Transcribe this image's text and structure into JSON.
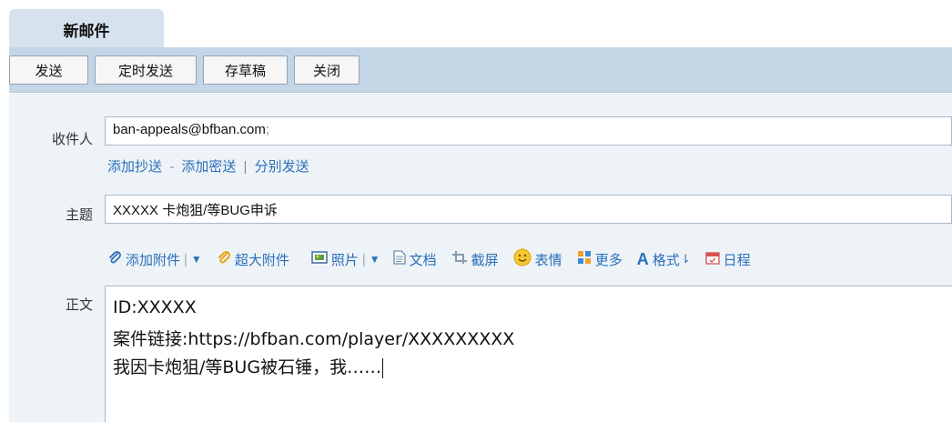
{
  "tab": {
    "title": "新邮件"
  },
  "toolbar": {
    "send": "发送",
    "scheduled_send": "定时发送",
    "save_draft": "存草稿",
    "close": "关闭"
  },
  "recipient": {
    "label": "收件人",
    "value": "ban-appeals@bfban.com",
    "separator": ";",
    "add_cc": "添加抄送",
    "dash": "-",
    "add_bcc": "添加密送",
    "pipe": "|",
    "separate_send": "分别发送"
  },
  "subject": {
    "label": "主题",
    "value": "XXXXX 卡炮狙/等BUG申诉"
  },
  "attach_bar": {
    "add_attachment": "添加附件",
    "large_attachment": "超大附件",
    "photo": "照片",
    "document": "文档",
    "screenshot": "截屏",
    "emoji": "表情",
    "more": "更多",
    "format": "格式",
    "schedule": "日程",
    "icons": [
      "paperclip-icon",
      "large-attachment-icon",
      "photo-icon",
      "document-icon",
      "screenshot-icon",
      "emoji-icon",
      "more-icon",
      "format-icon",
      "calendar-icon"
    ]
  },
  "body": {
    "label": "正文",
    "lines": [
      "ID:XXXXX",
      "案件链接:https://bfban.com/player/XXXXXXXXX",
      "我因卡炮狙/等BUG被石锤，我……"
    ]
  },
  "colors": {
    "toolbar_bg": "#c4d6e6",
    "tab_bg": "#d6e3ef",
    "form_bg": "#eef3f8",
    "link": "#2a6fb8"
  }
}
